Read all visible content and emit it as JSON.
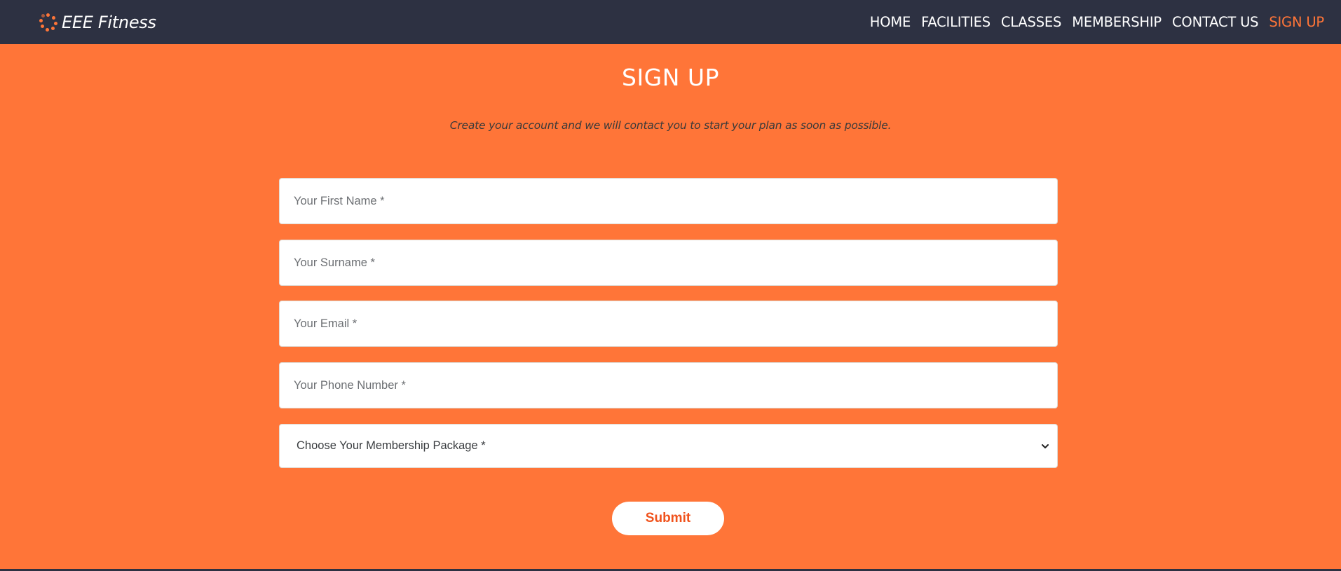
{
  "brand": {
    "name": "EEE Fitness",
    "icon": "spinner-dots-icon",
    "accent_color": "#ff7538"
  },
  "nav": {
    "items": [
      {
        "label": "HOME",
        "active": false
      },
      {
        "label": "FACILITIES",
        "active": false
      },
      {
        "label": "CLASSES",
        "active": false
      },
      {
        "label": "MEMBERSHIP",
        "active": false
      },
      {
        "label": "CONTACT US",
        "active": false
      },
      {
        "label": "SIGN UP",
        "active": true
      }
    ]
  },
  "page": {
    "title": "SIGN UP",
    "subtitle": "Create your account and we will contact you to start your plan as soon as possible.",
    "background_color": "#ff7538"
  },
  "form": {
    "first_name": {
      "placeholder": "Your First Name *",
      "value": ""
    },
    "surname": {
      "placeholder": "Your Surname *",
      "value": ""
    },
    "email": {
      "placeholder": "Your Email *",
      "value": ""
    },
    "phone": {
      "placeholder": "Your Phone Number *",
      "value": ""
    },
    "membership": {
      "selected": "Choose Your Membership Package *",
      "icon": "chevron-down-icon"
    },
    "submit_label": "Submit"
  },
  "colors": {
    "navbar": "#2d3142",
    "active_nav": "#ff7538",
    "submit_text": "#f0521c"
  }
}
